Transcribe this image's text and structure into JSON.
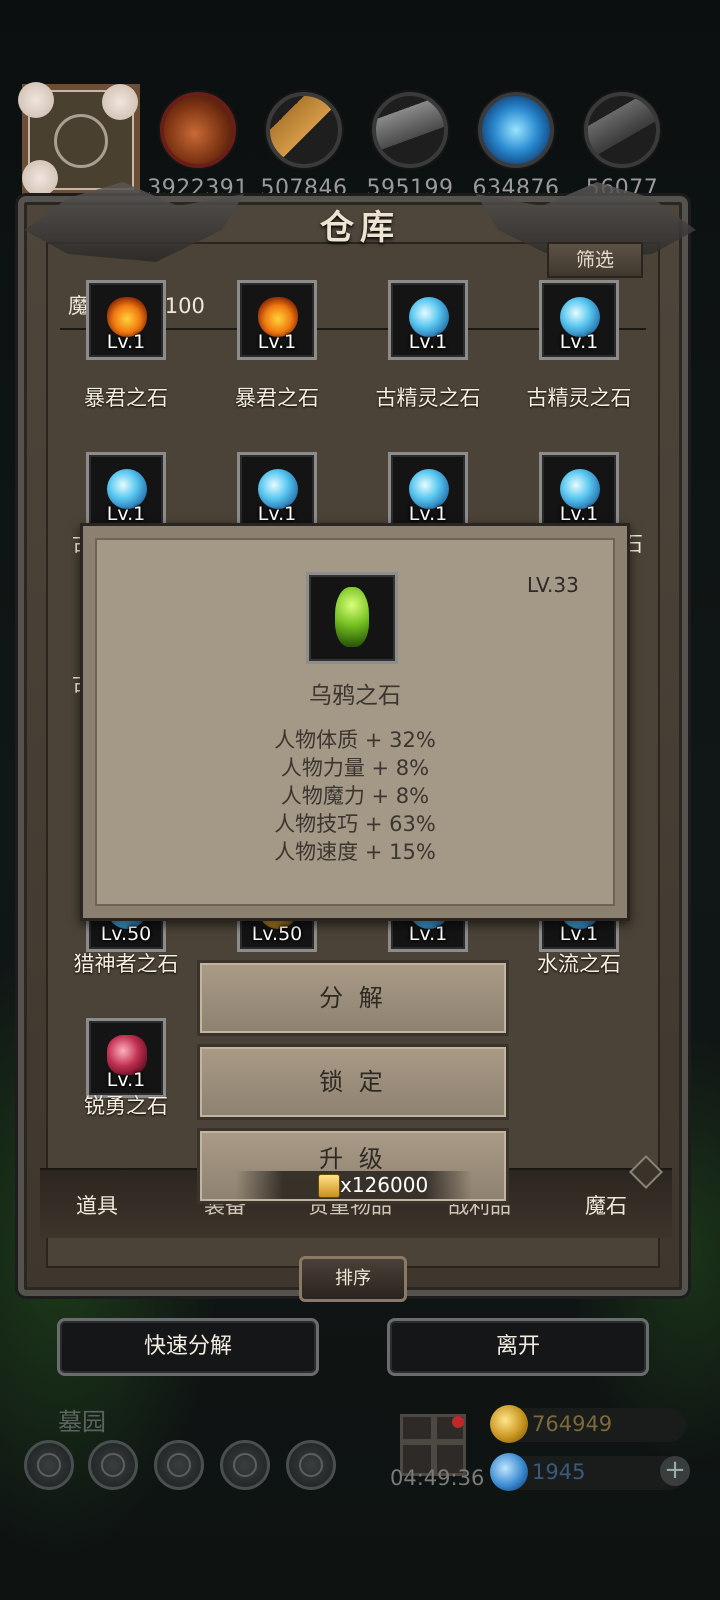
{
  "resources": [
    {
      "icon": "meat-icon",
      "value": "3922391"
    },
    {
      "icon": "wood-icon",
      "value": "507846"
    },
    {
      "icon": "stone-icon",
      "value": "595199"
    },
    {
      "icon": "crystal-icon",
      "value": "634876"
    },
    {
      "icon": "iron-icon",
      "value": "56077"
    }
  ],
  "panel": {
    "title": "仓库",
    "filter_label": "筛选",
    "count_label": "魔石：30/100"
  },
  "grid_rows": [
    [
      {
        "level": "Lv.1",
        "name": "暴君之石",
        "gem": "fire"
      },
      {
        "level": "Lv.1",
        "name": "暴君之石",
        "gem": "fire"
      },
      {
        "level": "Lv.1",
        "name": "古精灵之石",
        "gem": "ice"
      },
      {
        "level": "Lv.1",
        "name": "古精灵之石",
        "gem": "ice"
      }
    ],
    [
      {
        "level": "Lv.1",
        "name": "古",
        "gem": "ice"
      },
      {
        "level": "Lv.1",
        "name": "",
        "gem": "ice"
      },
      {
        "level": "Lv.1",
        "name": "",
        "gem": "ice"
      },
      {
        "level": "Lv.1",
        "name": "石",
        "gem": "ice"
      }
    ],
    [
      {
        "level": "Lv.50",
        "name": "猎神者之石",
        "gem": "ice"
      },
      {
        "level": "Lv.50",
        "name": "",
        "gem": "ice"
      },
      {
        "level": "Lv.1",
        "name": "",
        "gem": "ice"
      },
      {
        "level": "Lv.1",
        "name": "水流之石",
        "gem": "ice"
      }
    ],
    [
      {
        "level": "Lv.1",
        "name": "锐勇之石",
        "gem": "red"
      }
    ]
  ],
  "side_fragment": "古",
  "tabs": {
    "items": "道具",
    "equipment": "装备",
    "valuables": "贵重物品",
    "consumables": "战利品",
    "magic_stone": "魔石"
  },
  "sort_label": "排序",
  "bottom": {
    "quick_decompose": "快速分解",
    "leave": "离开"
  },
  "footer": {
    "location": "墓园",
    "timer": "04:49:36",
    "gold": "764949",
    "gems": "1945",
    "plus": "+"
  },
  "popup": {
    "level": "LV.33",
    "name": "乌鸦之石",
    "stats": [
      "人物体质 + 32%",
      "人物力量 + 8%",
      "人物魔力 + 8%",
      "人物技巧 + 63%",
      "人物速度 + 15%"
    ]
  },
  "actions": {
    "decompose": "分 解",
    "lock": "锁 定",
    "upgrade": "升 级",
    "upgrade_cost": "x126000"
  }
}
